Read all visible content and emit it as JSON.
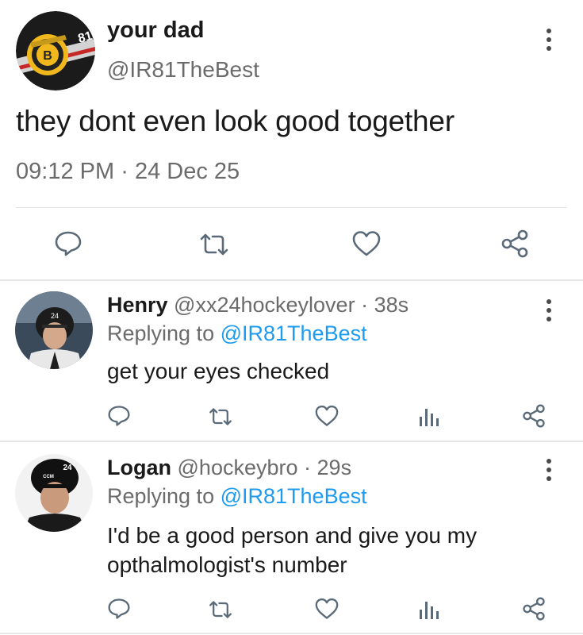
{
  "main_tweet": {
    "name": "your dad",
    "handle": "@IR81TheBest",
    "text": "they dont even look good together",
    "time": "09:12 PM",
    "separator": "·",
    "date": "24 Dec 25",
    "avatar_number": "81"
  },
  "replies": [
    {
      "name": "Henry",
      "handle": "@xx24hockeylover",
      "separator": "·",
      "age": "38s",
      "replying_prefix": "Replying to",
      "replying_to": "@IR81TheBest",
      "text": "get your eyes checked",
      "avatar_number": "24"
    },
    {
      "name": "Logan",
      "handle": "@hockeybro",
      "separator": "·",
      "age": "29s",
      "replying_prefix": "Replying to",
      "replying_to": "@IR81TheBest",
      "text": "I'd be a good person and give you my opthalmologist's number",
      "avatar_number": "24",
      "helmet_brand": "CCM"
    }
  ],
  "colors": {
    "mention": "#1d9bf0",
    "secondary_text": "#6b6b6b",
    "icon": "#5a6a78"
  },
  "icons": [
    "reply-icon",
    "retweet-icon",
    "like-icon",
    "share-icon",
    "analytics-icon",
    "more-options-icon"
  ]
}
